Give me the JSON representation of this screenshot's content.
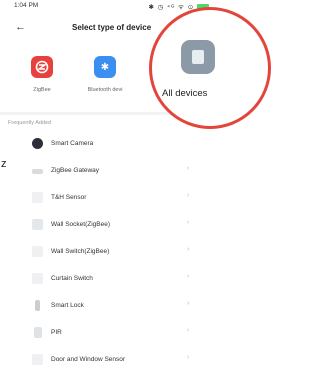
{
  "status": {
    "time": "1:04 PM",
    "icons": "✱ ◷ ⁴ᴳ ᯤ ⊙"
  },
  "header": {
    "back": "←",
    "title": "Select type of device"
  },
  "categories": [
    {
      "label": "ZigBee",
      "color": "#e8403d"
    },
    {
      "label": "Bluetooth devi",
      "color": "#3a8ff0"
    }
  ],
  "highlight": {
    "label": "All devices",
    "circle_color": "#e4453b"
  },
  "section": {
    "title": "Frequently Added"
  },
  "side_mark": "z",
  "devices": [
    {
      "name": "Smart Camera",
      "icon": "camera-icon"
    },
    {
      "name": "ZigBee Gateway",
      "icon": "gateway-icon"
    },
    {
      "name": "T&H Sensor",
      "icon": "sensor-icon"
    },
    {
      "name": "Wall Socket(ZigBee)",
      "icon": "socket-icon"
    },
    {
      "name": "Wall Switch(ZigBee)",
      "icon": "switch-icon"
    },
    {
      "name": "Curtain Switch",
      "icon": "curtain-switch-icon"
    },
    {
      "name": "Smart Lock",
      "icon": "lock-icon"
    },
    {
      "name": "PIR",
      "icon": "pir-icon"
    },
    {
      "name": "Door and Window Sensor",
      "icon": "door-sensor-icon"
    }
  ],
  "chevron": "›"
}
